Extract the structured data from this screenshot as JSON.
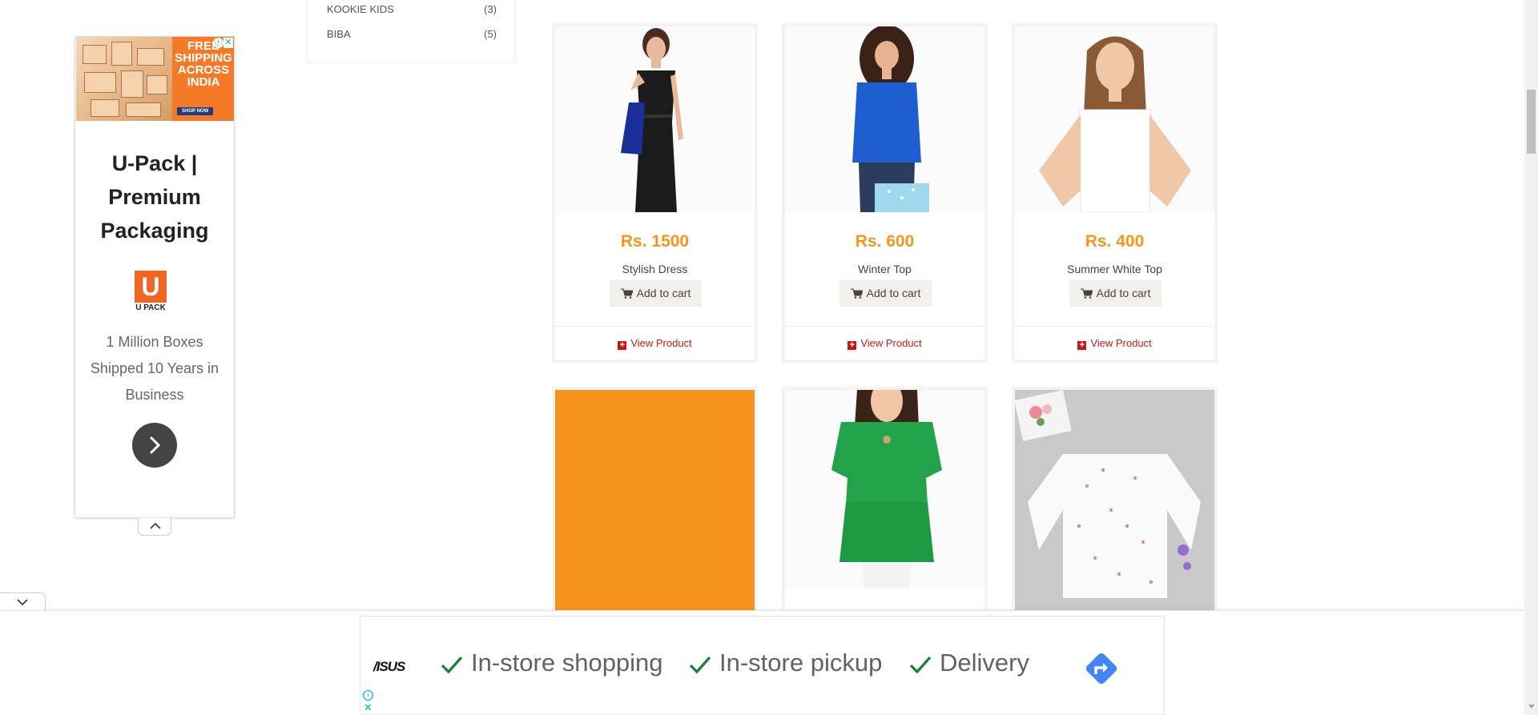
{
  "filter": {
    "items": [
      {
        "label": "KOOKIE KIDS",
        "count": "(3)"
      },
      {
        "label": "BIBA",
        "count": "(5)"
      }
    ]
  },
  "products": [
    {
      "price": "Rs. 1500",
      "name": "Stylish Dress",
      "cart_label": "Add to cart",
      "view_label": "View Product"
    },
    {
      "price": "Rs. 600",
      "name": "Winter Top",
      "cart_label": "Add to cart",
      "view_label": "View Product"
    },
    {
      "price": "Rs. 400",
      "name": "Summer White Top",
      "cart_label": "Add to cart",
      "view_label": "View Product"
    }
  ],
  "side_ad": {
    "banner_text": "FREE SHIPPING ACROSS INDIA",
    "banner_button": "SHOP NOW",
    "headline": "U-Pack | Premium Packaging",
    "logo_text": "U PACK",
    "description": "1 Million Boxes Shipped 10 Years in Business",
    "info_icon": "ⓘ",
    "close_icon": "✕"
  },
  "bottom_ad": {
    "brand": "/ISUS",
    "features": [
      "In-store shopping",
      "In-store pickup",
      "Delivery"
    ],
    "info_icon": "ⓘ",
    "close_icon": "✕"
  },
  "colors": {
    "price": "#f7941d",
    "view_link": "#c01b1b",
    "orange_placeholder": "#f7941d",
    "ad_accent": "#f47a2a",
    "direction_icon": "#4285f4"
  },
  "icons": {
    "cart": "cart-icon",
    "view": "plus-square-icon",
    "check": "check-icon",
    "directions": "directions-icon",
    "chevron_right": "chevron-right-icon",
    "chevron_up": "chevron-up-icon",
    "chevron_down": "chevron-down-icon"
  }
}
